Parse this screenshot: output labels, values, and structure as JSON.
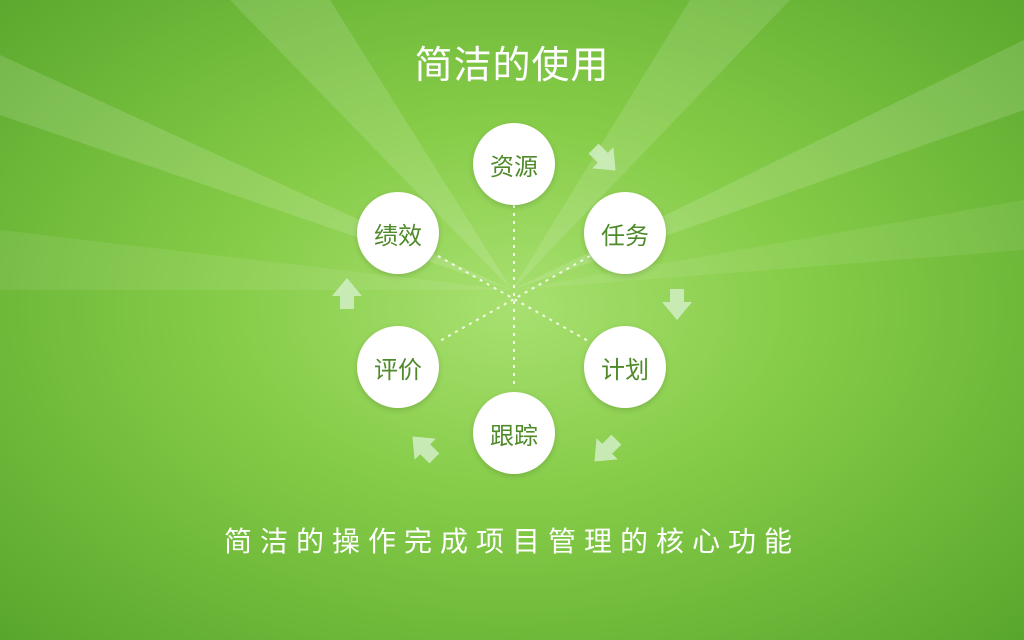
{
  "title": "简洁的使用",
  "tagline": "简洁的操作完成项目管理的核心功能",
  "nodes": {
    "resources": "资源",
    "tasks": "任务",
    "planning": "计划",
    "tracking": "跟踪",
    "evaluation": "评价",
    "performance": "绩效"
  },
  "colors": {
    "background_light": "#a8e070",
    "background_dark": "#58a62c",
    "node_fill": "#ffffff",
    "node_text": "#4f8a2a",
    "arrow": "#cfeec0"
  }
}
